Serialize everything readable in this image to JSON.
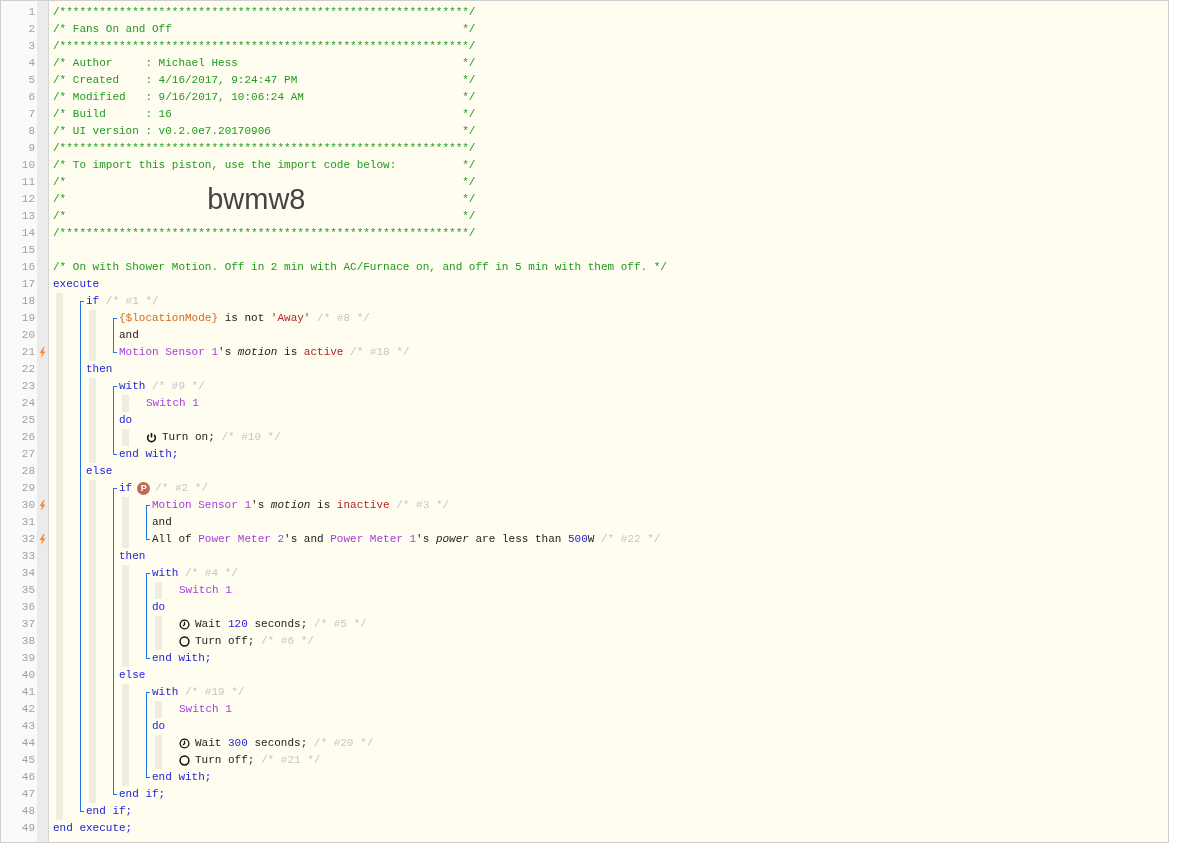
{
  "code": [
    {
      "kind": "line",
      "number": "1",
      "trigger": false,
      "tokens": [
        {
          "kind": "comment",
          "text": "/**************************************************************/"
        }
      ]
    },
    {
      "kind": "line",
      "number": "2",
      "trigger": false,
      "tokens": [
        {
          "kind": "comment",
          "text": "/* Fans On and Off                                            */"
        }
      ]
    },
    {
      "kind": "line",
      "number": "3",
      "trigger": false,
      "tokens": [
        {
          "kind": "comment",
          "text": "/**************************************************************/"
        }
      ]
    },
    {
      "kind": "line",
      "number": "4",
      "trigger": false,
      "tokens": [
        {
          "kind": "comment",
          "text": "/* Author     : Michael Hess                                  */"
        }
      ]
    },
    {
      "kind": "line",
      "number": "5",
      "trigger": false,
      "tokens": [
        {
          "kind": "comment",
          "text": "/* Created    : 4/16/2017, 9:24:47 PM                         */"
        }
      ]
    },
    {
      "kind": "line",
      "number": "6",
      "trigger": false,
      "tokens": [
        {
          "kind": "comment",
          "text": "/* Modified   : 9/16/2017, 10:06:24 AM                        */"
        }
      ]
    },
    {
      "kind": "line",
      "number": "7",
      "trigger": false,
      "tokens": [
        {
          "kind": "comment",
          "text": "/* Build      : 16                                            */"
        }
      ]
    },
    {
      "kind": "line",
      "number": "8",
      "trigger": false,
      "tokens": [
        {
          "kind": "comment",
          "text": "/* UI version : v0.2.0e7.20170906                             */"
        }
      ]
    },
    {
      "kind": "line",
      "number": "9",
      "trigger": false,
      "tokens": [
        {
          "kind": "comment",
          "text": "/**************************************************************/"
        }
      ]
    },
    {
      "kind": "line",
      "number": "10",
      "trigger": false,
      "tokens": [
        {
          "kind": "comment",
          "text": "/* To import this piston, use the import code below:          */"
        }
      ]
    },
    {
      "kind": "line",
      "number": "11",
      "trigger": false,
      "tokens": [
        {
          "kind": "comment",
          "text": "/*                                                            */"
        }
      ]
    },
    {
      "kind": "line",
      "number": "12",
      "trigger": false,
      "tokens": [
        {
          "kind": "comment",
          "text": "/*"
        },
        {
          "kind": "import_code",
          "text": "bwmw8"
        },
        {
          "kind": "comment",
          "text": "*/"
        }
      ]
    },
    {
      "kind": "line",
      "number": "13",
      "trigger": false,
      "tokens": [
        {
          "kind": "comment",
          "text": "/*                                                            */"
        }
      ]
    },
    {
      "kind": "line",
      "number": "14",
      "trigger": false,
      "tokens": [
        {
          "kind": "comment",
          "text": "/**************************************************************/"
        }
      ]
    },
    {
      "kind": "line",
      "number": "15",
      "trigger": false
    },
    {
      "kind": "line",
      "number": "16",
      "trigger": false,
      "tokens": [
        {
          "kind": "comment",
          "text": "/* On with Shower Motion. Off in 2 min with AC/Furnace on, and off in 5 min with them off. */"
        }
      ]
    },
    {
      "kind": "line",
      "number": "17",
      "trigger": false,
      "tokens": [
        {
          "kind": "keyword",
          "text": "execute"
        }
      ]
    },
    {
      "kind": "body",
      "items": [
        {
          "kind": "statement",
          "items": [
            {
              "kind": "line",
              "number": "18",
              "trigger": false,
              "tokens": [
                {
                  "kind": "keyword",
                  "text": "if"
                },
                {
                  "kind": "note",
                  "text": " /* #1 */"
                }
              ]
            },
            {
              "kind": "body",
              "items": [
                {
                  "kind": "statement",
                  "items": [
                    {
                      "kind": "line",
                      "number": "19",
                      "trigger": false,
                      "tokens": [
                        {
                          "kind": "variable",
                          "text": "{$locationMode}"
                        },
                        {
                          "kind": "plain",
                          "text": " is not "
                        },
                        {
                          "kind": "string",
                          "text": "'Away'"
                        },
                        {
                          "kind": "note",
                          "text": " /* #8 */"
                        }
                      ]
                    },
                    {
                      "kind": "line",
                      "number": "20",
                      "trigger": false,
                      "tokens": [
                        {
                          "kind": "plain",
                          "text": "and"
                        }
                      ]
                    },
                    {
                      "kind": "line",
                      "number": "21",
                      "trigger": true,
                      "tokens": [
                        {
                          "kind": "device",
                          "text": "Motion Sensor 1"
                        },
                        {
                          "kind": "plain",
                          "text": "'s "
                        },
                        {
                          "kind": "attribute",
                          "text": "motion"
                        },
                        {
                          "kind": "plain",
                          "text": " is "
                        },
                        {
                          "kind": "value",
                          "text": "active"
                        },
                        {
                          "kind": "note",
                          "text": " /* #18 */"
                        }
                      ]
                    }
                  ]
                }
              ]
            },
            {
              "kind": "line",
              "number": "22",
              "trigger": false,
              "tokens": [
                {
                  "kind": "keyword",
                  "text": "then"
                }
              ]
            },
            {
              "kind": "body",
              "items": [
                {
                  "kind": "statement",
                  "items": [
                    {
                      "kind": "line",
                      "number": "23",
                      "trigger": false,
                      "tokens": [
                        {
                          "kind": "keyword",
                          "text": "with"
                        },
                        {
                          "kind": "note",
                          "text": " /* #9 */"
                        }
                      ]
                    },
                    {
                      "kind": "body",
                      "items": [
                        {
                          "kind": "line",
                          "number": "24",
                          "trigger": false,
                          "tokens": [
                            {
                              "kind": "device",
                              "text": "Switch 1"
                            }
                          ]
                        }
                      ]
                    },
                    {
                      "kind": "line",
                      "number": "25",
                      "trigger": false,
                      "tokens": [
                        {
                          "kind": "keyword",
                          "text": "do"
                        }
                      ]
                    },
                    {
                      "kind": "body",
                      "items": [
                        {
                          "kind": "line",
                          "number": "26",
                          "trigger": false,
                          "tokens": [
                            {
                              "kind": "turn_on_icon"
                            },
                            {
                              "kind": "plain",
                              "text": "Turn on;"
                            },
                            {
                              "kind": "note",
                              "text": " /* #10 */"
                            }
                          ]
                        }
                      ]
                    },
                    {
                      "kind": "line",
                      "number": "27",
                      "trigger": false,
                      "tokens": [
                        {
                          "kind": "keyword",
                          "text": "end with;"
                        }
                      ]
                    }
                  ]
                }
              ]
            },
            {
              "kind": "line",
              "number": "28",
              "trigger": false,
              "tokens": [
                {
                  "kind": "keyword",
                  "text": "else"
                }
              ]
            },
            {
              "kind": "body",
              "items": [
                {
                  "kind": "statement",
                  "items": [
                    {
                      "kind": "line",
                      "number": "29",
                      "trigger": false,
                      "tokens": [
                        {
                          "kind": "keyword",
                          "text": "if"
                        },
                        {
                          "kind": "badge",
                          "text": "P"
                        },
                        {
                          "kind": "note",
                          "text": "/* #2 */"
                        }
                      ]
                    },
                    {
                      "kind": "body",
                      "items": [
                        {
                          "kind": "statement",
                          "items": [
                            {
                              "kind": "line",
                              "number": "30",
                              "trigger": true,
                              "tokens": [
                                {
                                  "kind": "device",
                                  "text": "Motion Sensor 1"
                                },
                                {
                                  "kind": "plain",
                                  "text": "'s "
                                },
                                {
                                  "kind": "attribute",
                                  "text": "motion"
                                },
                                {
                                  "kind": "plain",
                                  "text": " is "
                                },
                                {
                                  "kind": "value",
                                  "text": "inactive"
                                },
                                {
                                  "kind": "note",
                                  "text": " /* #3 */"
                                }
                              ]
                            },
                            {
                              "kind": "line",
                              "number": "31",
                              "trigger": false,
                              "tokens": [
                                {
                                  "kind": "plain",
                                  "text": "and"
                                }
                              ]
                            },
                            {
                              "kind": "line",
                              "number": "32",
                              "trigger": true,
                              "tokens": [
                                {
                                  "kind": "plain",
                                  "text": "All of "
                                },
                                {
                                  "kind": "device",
                                  "text": "Power Meter 2"
                                },
                                {
                                  "kind": "plain",
                                  "text": "'s and "
                                },
                                {
                                  "kind": "device",
                                  "text": "Power Meter 1"
                                },
                                {
                                  "kind": "plain",
                                  "text": "'s "
                                },
                                {
                                  "kind": "attribute",
                                  "text": "power"
                                },
                                {
                                  "kind": "plain",
                                  "text": " are less than "
                                },
                                {
                                  "kind": "number",
                                  "text": "500"
                                },
                                {
                                  "kind": "plain",
                                  "text": "W"
                                },
                                {
                                  "kind": "note",
                                  "text": " /* #22 */"
                                }
                              ]
                            }
                          ]
                        }
                      ]
                    },
                    {
                      "kind": "line",
                      "number": "33",
                      "trigger": false,
                      "tokens": [
                        {
                          "kind": "keyword",
                          "text": "then"
                        }
                      ]
                    },
                    {
                      "kind": "body",
                      "items": [
                        {
                          "kind": "statement",
                          "items": [
                            {
                              "kind": "line",
                              "number": "34",
                              "trigger": false,
                              "tokens": [
                                {
                                  "kind": "keyword",
                                  "text": "with"
                                },
                                {
                                  "kind": "note",
                                  "text": " /* #4 */"
                                }
                              ]
                            },
                            {
                              "kind": "body",
                              "items": [
                                {
                                  "kind": "line",
                                  "number": "35",
                                  "trigger": false,
                                  "tokens": [
                                    {
                                      "kind": "device",
                                      "text": "Switch 1"
                                    }
                                  ]
                                }
                              ]
                            },
                            {
                              "kind": "line",
                              "number": "36",
                              "trigger": false,
                              "tokens": [
                                {
                                  "kind": "keyword",
                                  "text": "do"
                                }
                              ]
                            },
                            {
                              "kind": "body",
                              "items": [
                                {
                                  "kind": "line",
                                  "number": "37",
                                  "trigger": false,
                                  "tokens": [
                                    {
                                      "kind": "wait_icon"
                                    },
                                    {
                                      "kind": "plain",
                                      "text": "Wait "
                                    },
                                    {
                                      "kind": "number",
                                      "text": "120"
                                    },
                                    {
                                      "kind": "plain",
                                      "text": " seconds;"
                                    },
                                    {
                                      "kind": "note",
                                      "text": " /* #5 */"
                                    }
                                  ]
                                },
                                {
                                  "kind": "line",
                                  "number": "38",
                                  "trigger": false,
                                  "tokens": [
                                    {
                                      "kind": "turn_off_icon"
                                    },
                                    {
                                      "kind": "plain",
                                      "text": "Turn off;"
                                    },
                                    {
                                      "kind": "note",
                                      "text": " /* #6 */"
                                    }
                                  ]
                                }
                              ]
                            },
                            {
                              "kind": "line",
                              "number": "39",
                              "trigger": false,
                              "tokens": [
                                {
                                  "kind": "keyword",
                                  "text": "end with;"
                                }
                              ]
                            }
                          ]
                        }
                      ]
                    },
                    {
                      "kind": "line",
                      "number": "40",
                      "trigger": false,
                      "tokens": [
                        {
                          "kind": "keyword",
                          "text": "else"
                        }
                      ]
                    },
                    {
                      "kind": "body",
                      "items": [
                        {
                          "kind": "statement",
                          "items": [
                            {
                              "kind": "line",
                              "number": "41",
                              "trigger": false,
                              "tokens": [
                                {
                                  "kind": "keyword",
                                  "text": "with"
                                },
                                {
                                  "kind": "note",
                                  "text": " /* #19 */"
                                }
                              ]
                            },
                            {
                              "kind": "body",
                              "items": [
                                {
                                  "kind": "line",
                                  "number": "42",
                                  "trigger": false,
                                  "tokens": [
                                    {
                                      "kind": "device",
                                      "text": "Switch 1"
                                    }
                                  ]
                                }
                              ]
                            },
                            {
                              "kind": "line",
                              "number": "43",
                              "trigger": false,
                              "tokens": [
                                {
                                  "kind": "keyword",
                                  "text": "do"
                                }
                              ]
                            },
                            {
                              "kind": "body",
                              "items": [
                                {
                                  "kind": "line",
                                  "number": "44",
                                  "trigger": false,
                                  "tokens": [
                                    {
                                      "kind": "wait_icon"
                                    },
                                    {
                                      "kind": "plain",
                                      "text": "Wait "
                                    },
                                    {
                                      "kind": "number",
                                      "text": "300"
                                    },
                                    {
                                      "kind": "plain",
                                      "text": " seconds;"
                                    },
                                    {
                                      "kind": "note",
                                      "text": " /* #20 */"
                                    }
                                  ]
                                },
                                {
                                  "kind": "line",
                                  "number": "45",
                                  "trigger": false,
                                  "tokens": [
                                    {
                                      "kind": "turn_off_icon"
                                    },
                                    {
                                      "kind": "plain",
                                      "text": "Turn off;"
                                    },
                                    {
                                      "kind": "note",
                                      "text": " /* #21 */"
                                    }
                                  ]
                                }
                              ]
                            },
                            {
                              "kind": "line",
                              "number": "46",
                              "trigger": false,
                              "tokens": [
                                {
                                  "kind": "keyword",
                                  "text": "end with;"
                                }
                              ]
                            }
                          ]
                        }
                      ]
                    },
                    {
                      "kind": "line",
                      "number": "47",
                      "trigger": false,
                      "tokens": [
                        {
                          "kind": "keyword",
                          "text": "end if;"
                        }
                      ]
                    }
                  ]
                }
              ]
            },
            {
              "kind": "line",
              "number": "48",
              "trigger": false,
              "tokens": [
                {
                  "kind": "keyword",
                  "text": "end if;"
                }
              ]
            }
          ]
        }
      ]
    },
    {
      "kind": "line",
      "number": "49",
      "trigger": false,
      "tokens": [
        {
          "kind": "keyword",
          "text": "end execute;"
        }
      ]
    }
  ]
}
